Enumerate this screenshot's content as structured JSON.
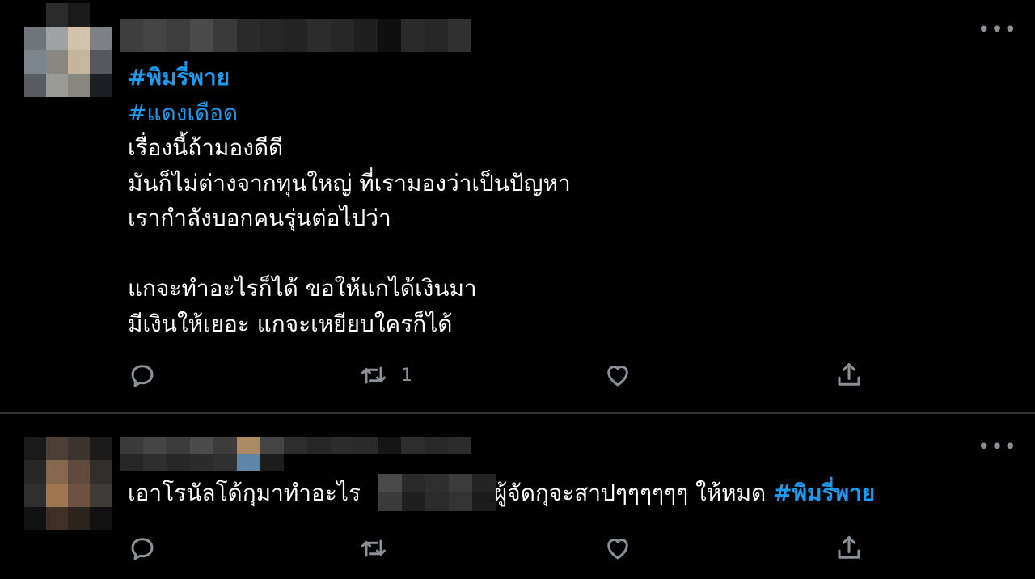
{
  "tweets": [
    {
      "hashtags": [
        "#พิมรี่พาย",
        "#แดงเดือด"
      ],
      "lines": [
        "เรื่องนี้ถ้ามองดีดี",
        "มันก็ไม่ต่างจากทุนใหญ่ ที่เรามองว่าเป็นปัญหา",
        "เรากำลังบอกคนรุ่นต่อไปว่า",
        "",
        "แกจะทำอะไรก็ได้ ขอให้แกได้เงินมา",
        "มีเงินให้เยอะ แกจะเหยียบใครก็ได้"
      ],
      "actions": {
        "reply_icon": "reply-icon",
        "retweet_icon": "retweet-icon",
        "retweet_count": "1",
        "like_icon": "heart-icon",
        "share_icon": "share-icon"
      },
      "more_label": "•••"
    },
    {
      "text_before": "เอาโรนัลโด้กุมาทำอะไร",
      "text_after": " ผู้จัดกุจะสาปๆๆๆๆๆๆ ให้หมด ",
      "hashtag": "#พิมรี่พาย",
      "actions": {
        "reply_icon": "reply-icon",
        "retweet_icon": "retweet-icon",
        "like_icon": "heart-icon",
        "share_icon": "share-icon"
      },
      "more_label": "•••"
    }
  ],
  "colors": {
    "background": "#000000",
    "hashtag": "#1d9bf0",
    "text": "#ffffff",
    "muted": "#8b9197",
    "divider": "#2f3336"
  }
}
